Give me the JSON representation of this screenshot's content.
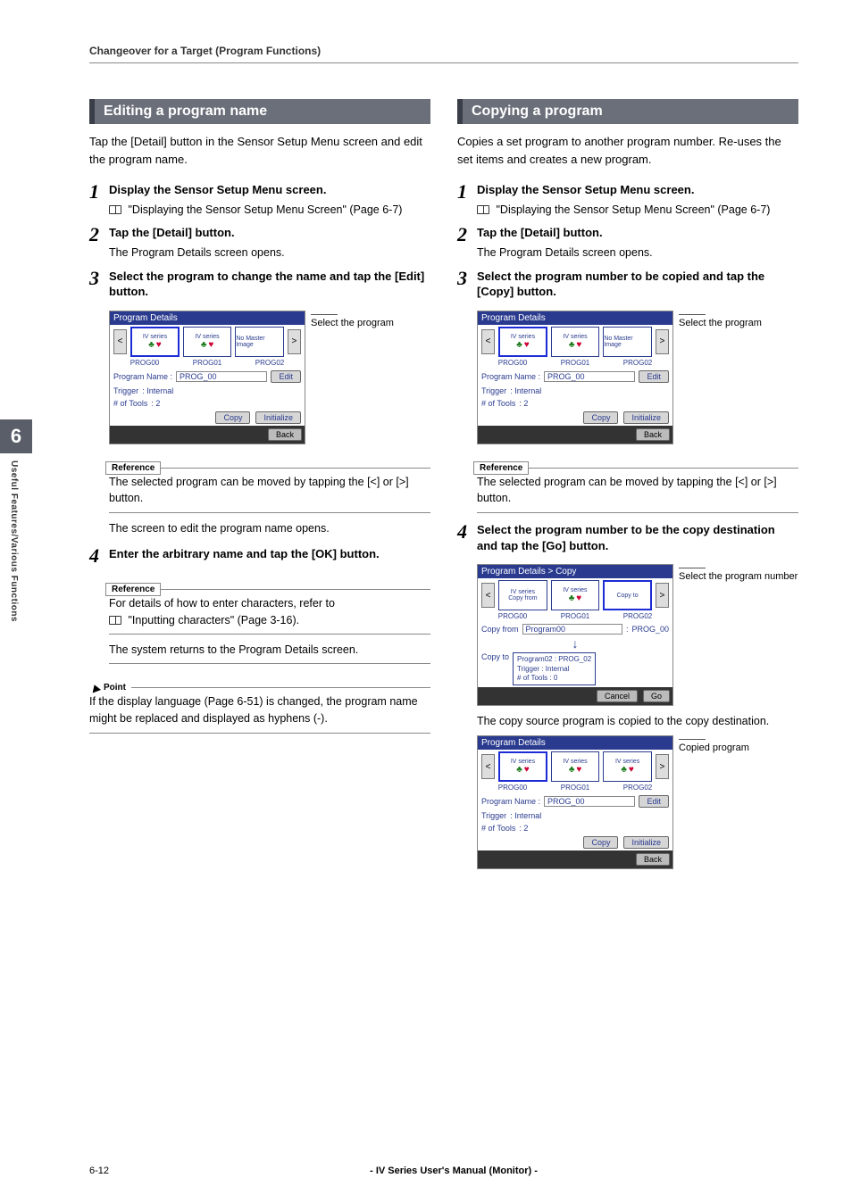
{
  "running_head": "Changeover for a Target (Program Functions)",
  "side_tab": {
    "chapter": "6",
    "label": "Useful Features/Various Functions"
  },
  "left": {
    "title": "Editing a program name",
    "intro": "Tap the [Detail] button in the Sensor Setup Menu screen and edit the program name.",
    "step1_title": "Display the Sensor Setup Menu screen.",
    "step1_ref": "\"Displaying the Sensor Setup Menu Screen\" (Page 6-7)",
    "step2_title": "Tap the [Detail] button.",
    "step2_sub": "The Program Details screen opens.",
    "step3_title": "Select the program to change the name and tap the [Edit] button.",
    "annot3": "Select the program",
    "ref3": "The selected program can be moved by tapping the [<] or [>] button.",
    "post_ref3": "The screen to edit the program name opens.",
    "step4_title": "Enter the arbitrary name and tap the [OK] button.",
    "ref4": "For details of how to enter characters, refer to",
    "ref4b": "\"Inputting characters\" (Page 3-16).",
    "sys_return": "The system returns to the Program Details screen.",
    "point": "If the display language (Page 6-51) is changed, the program name might be replaced and displayed as hyphens (-).",
    "point_label": "Point",
    "ref_label": "Reference"
  },
  "right": {
    "title": "Copying a program",
    "intro": "Copies a set program to another program number. Re-uses the set items and creates a new program.",
    "step1_title": "Display the Sensor Setup Menu screen.",
    "step1_ref": "\"Displaying the Sensor Setup Menu Screen\" (Page 6-7)",
    "step2_title": "Tap the [Detail] button.",
    "step2_sub": "The Program Details screen opens.",
    "step3_title": "Select the program number to be copied and tap the [Copy] button.",
    "annot3": "Select the program",
    "ref3": "The selected program can be moved by tapping the [<] or [>] button.",
    "step4_title": "Select the program number to be the copy destination and tap the [Go] button.",
    "annot4": "Select the program number",
    "post4": "The copy source program is copied to the copy destination.",
    "annot5": "Copied program",
    "ref_label": "Reference"
  },
  "ss": {
    "details_title": "Program Details",
    "copy_title": "Program Details > Copy",
    "iv_series": "IV series",
    "no_master": "No Master Image",
    "prog00": "PROG00",
    "prog01": "PROG01",
    "prog02": "PROG02",
    "prog_name_label": "Program Name :",
    "prog00_val": "PROG_00",
    "prog02_val": "PROG_02",
    "edit": "Edit",
    "trigger_label": "Trigger",
    "trigger_val": ": Internal",
    "tools_label": "# of Tools",
    "tools_val": ": 2",
    "tools_val0": ": 0",
    "copy": "Copy",
    "initialize": "Initialize",
    "back": "Back",
    "copy_from_label": "Copy from",
    "copy_to_label": "Copy to",
    "copy_from_val": "Program00",
    "copy_to_val": "Program02",
    "cancel": "Cancel",
    "go": "Go",
    "copy_from_thumb": "Copy from",
    "copy_to_thumb": "Copy to"
  },
  "footer": {
    "page": "6-12",
    "title": "- IV Series User's Manual (Monitor) -"
  }
}
